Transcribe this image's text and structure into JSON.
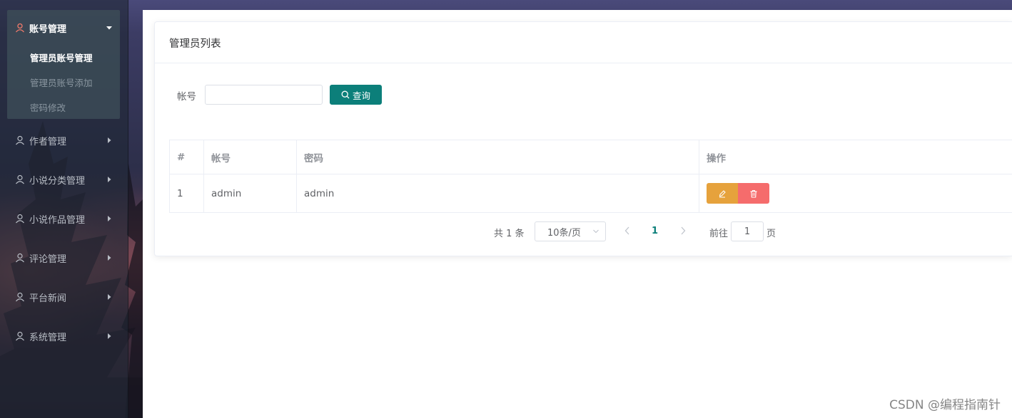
{
  "sidebar": {
    "groups": [
      {
        "label": "账号管理",
        "icon": "user-icon",
        "expanded": true,
        "items": [
          {
            "label": "管理员账号管理",
            "active": true
          },
          {
            "label": "管理员账号添加",
            "active": false
          },
          {
            "label": "密码修改",
            "active": false
          }
        ]
      },
      {
        "label": "作者管理",
        "icon": "user-icon",
        "expanded": false
      },
      {
        "label": "小说分类管理",
        "icon": "user-icon",
        "expanded": false
      },
      {
        "label": "小说作品管理",
        "icon": "user-icon",
        "expanded": false
      },
      {
        "label": "评论管理",
        "icon": "user-icon",
        "expanded": false
      },
      {
        "label": "平台新闻",
        "icon": "user-icon",
        "expanded": false
      },
      {
        "label": "系统管理",
        "icon": "user-icon",
        "expanded": false
      }
    ]
  },
  "card": {
    "title": "管理员列表"
  },
  "search": {
    "label": "帐号",
    "value": "",
    "placeholder": "",
    "button_label": "查询",
    "button_icon": "search-icon"
  },
  "table": {
    "columns": [
      "#",
      "帐号",
      "密码",
      "操作"
    ],
    "rows": [
      {
        "index": "1",
        "account": "admin",
        "password": "admin"
      }
    ],
    "actions": {
      "edit_icon": "edit-icon",
      "delete_icon": "trash-icon"
    }
  },
  "pagination": {
    "total_text": "共 1 条",
    "page_size": "10条/页",
    "current_page": "1",
    "goto_label": "前往",
    "goto_value": "1",
    "page_suffix": "页"
  },
  "colors": {
    "accent": "#0c7f7a",
    "edit": "#e6a23c",
    "delete": "#f56c6c",
    "active_menu_icon": "#f07a6a"
  },
  "watermark": "CSDN @编程指南针"
}
